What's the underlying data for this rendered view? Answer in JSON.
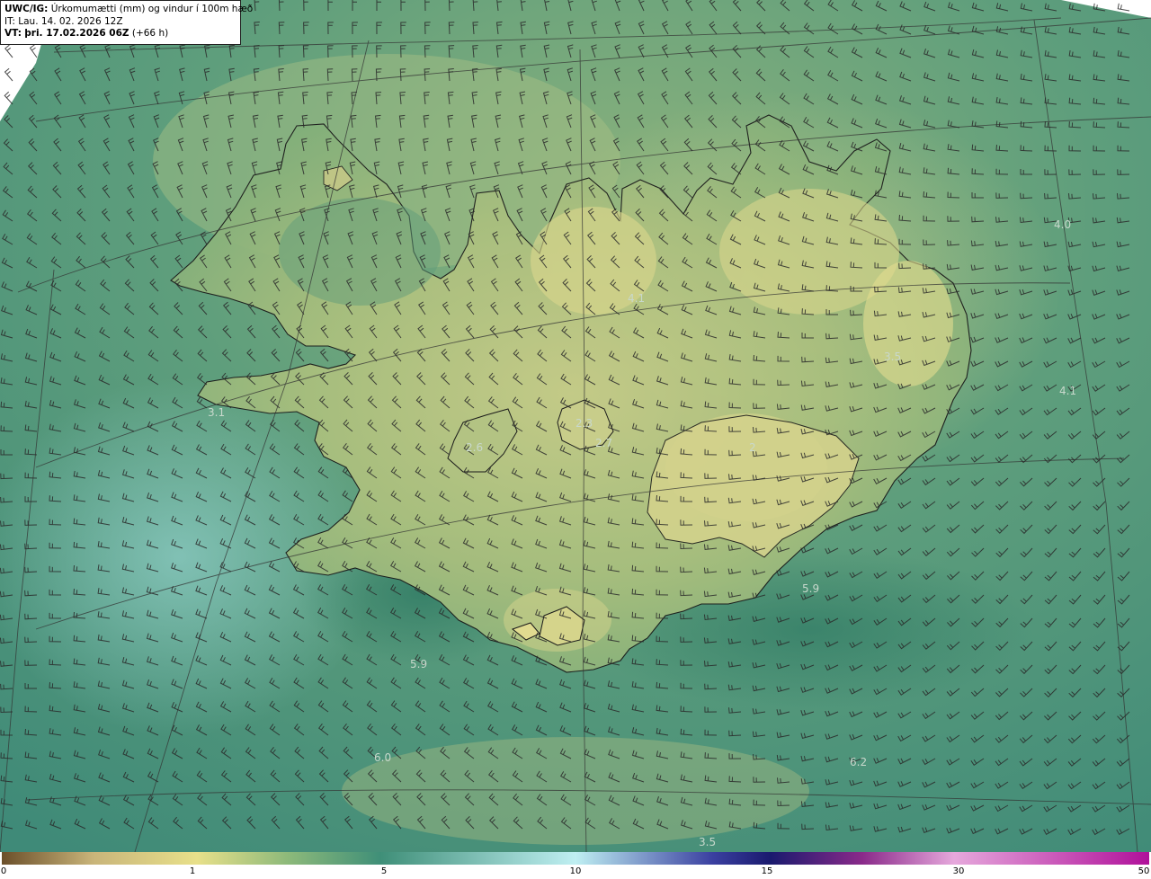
{
  "header": {
    "model_label": "UWC/IG:",
    "title": "Úrkomumætti (mm) og vindur í 100m hæð",
    "init_prefix": "IT:",
    "init_time": "Lau. 14. 02. 2026 12Z",
    "valid_prefix": "VT:",
    "valid_time": "þri. 17.02.2026 06Z",
    "lead_time": "(+66 h)"
  },
  "field_labels": [
    "4.0",
    "4.1",
    "3.5",
    "4.1",
    "3.1",
    "2.6",
    "2.3",
    "2.7",
    "2",
    "5.9",
    "5.9",
    "6.0",
    "6.2",
    "3.5"
  ],
  "colorbar": {
    "ticks": [
      "0",
      "1",
      "5",
      "10",
      "15",
      "30",
      "50"
    ],
    "colors": {
      "low": "#6b4f2a",
      "tan": "#c9b57a",
      "yellow": "#e8e08a",
      "green": "#8cb97a",
      "teal": "#3f8f78",
      "cyan": "#bfeff2",
      "blue": "#3a3fa0",
      "navy": "#1a1a6e",
      "purple": "#8a2a8a",
      "pink": "#e6a8dc",
      "magenta": "#b0109a"
    }
  }
}
